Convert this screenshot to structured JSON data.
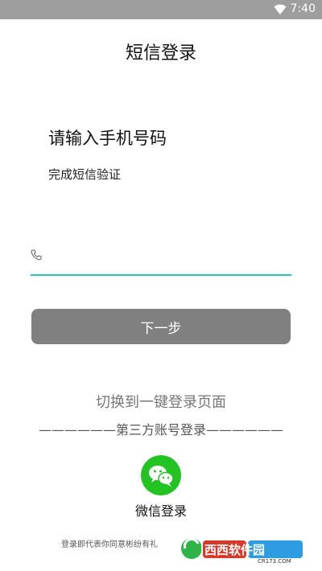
{
  "status_bar": {
    "time": "7:40",
    "wifi_icon": "wifi-icon"
  },
  "page": {
    "title": "短信登录"
  },
  "form": {
    "heading": "请输入手机号码",
    "subheading": "完成短信验证",
    "phone_input": {
      "value": "",
      "placeholder": "",
      "icon": "phone-icon"
    },
    "next_button": "下一步",
    "accent_color": "#27c6b6",
    "button_color": "#808080"
  },
  "alt_login": {
    "switch_text": "切换到一键登录页面",
    "third_party_divider": "——————第三方账号登录——————",
    "wechat_label": "微信登录",
    "wechat_icon": "wechat-icon",
    "wechat_color": "#22c322"
  },
  "footer": {
    "agreement_text": "登录即代表你同意彬纷有礼",
    "watermark_text": "西西软件园",
    "watermark_sub": "CR173.COM"
  }
}
